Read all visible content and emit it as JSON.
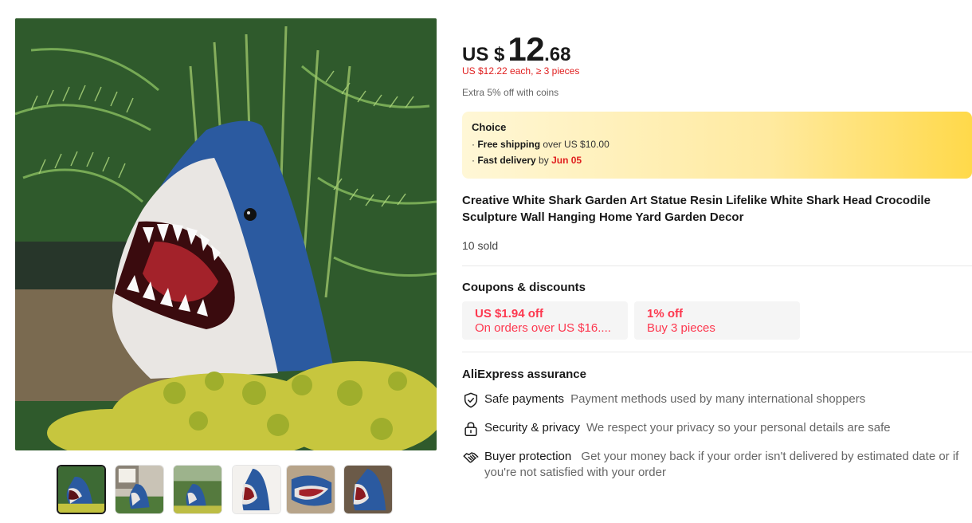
{
  "gallery": {
    "main_image_alt": "shark head garden sculpture",
    "thumbnails": [
      {
        "name": "thumb-1"
      },
      {
        "name": "thumb-2"
      },
      {
        "name": "thumb-3"
      },
      {
        "name": "thumb-4"
      },
      {
        "name": "thumb-5"
      },
      {
        "name": "thumb-6"
      }
    ]
  },
  "price": {
    "currency": "US $",
    "integer": "12",
    "decimal": ".68",
    "bulk_note": "US $12.22 each, ≥ 3 pieces",
    "coins_note": "Extra 5% off with coins"
  },
  "choice": {
    "badge": "Choice",
    "shipping_prefix": "· ",
    "shipping_bold": "Free shipping",
    "shipping_rest": " over US $10.00",
    "delivery_prefix": "· ",
    "delivery_bold": "Fast delivery",
    "delivery_mid": " by ",
    "delivery_date": "Jun 05"
  },
  "product": {
    "title": "Creative White Shark Garden Art Statue Resin Lifelike White Shark Head Crocodile Sculpture Wall Hanging Home Yard Garden Decor",
    "sold": "10 sold"
  },
  "coupons": {
    "title": "Coupons & discounts",
    "items": [
      {
        "amount": "US $1.94 off",
        "condition": "On orders over US $16...."
      },
      {
        "amount": "1% off",
        "condition": "Buy 3 pieces"
      }
    ]
  },
  "assurance": {
    "title": "AliExpress assurance",
    "items": [
      {
        "name": "Safe payments",
        "desc": "Payment methods used by many international shoppers",
        "icon": "shield-check-icon"
      },
      {
        "name": "Security & privacy",
        "desc": "We respect your privacy so your personal details are safe",
        "icon": "lock-icon"
      },
      {
        "name": "Buyer protection",
        "desc": "Get your money back if your order isn't delivered by estimated date or if you're not satisfied with your order",
        "icon": "handshake-icon"
      }
    ]
  },
  "colors": {
    "accent_red": "#fd384f",
    "price_red": "#e02020",
    "choice_gold": "#ffd94a"
  }
}
